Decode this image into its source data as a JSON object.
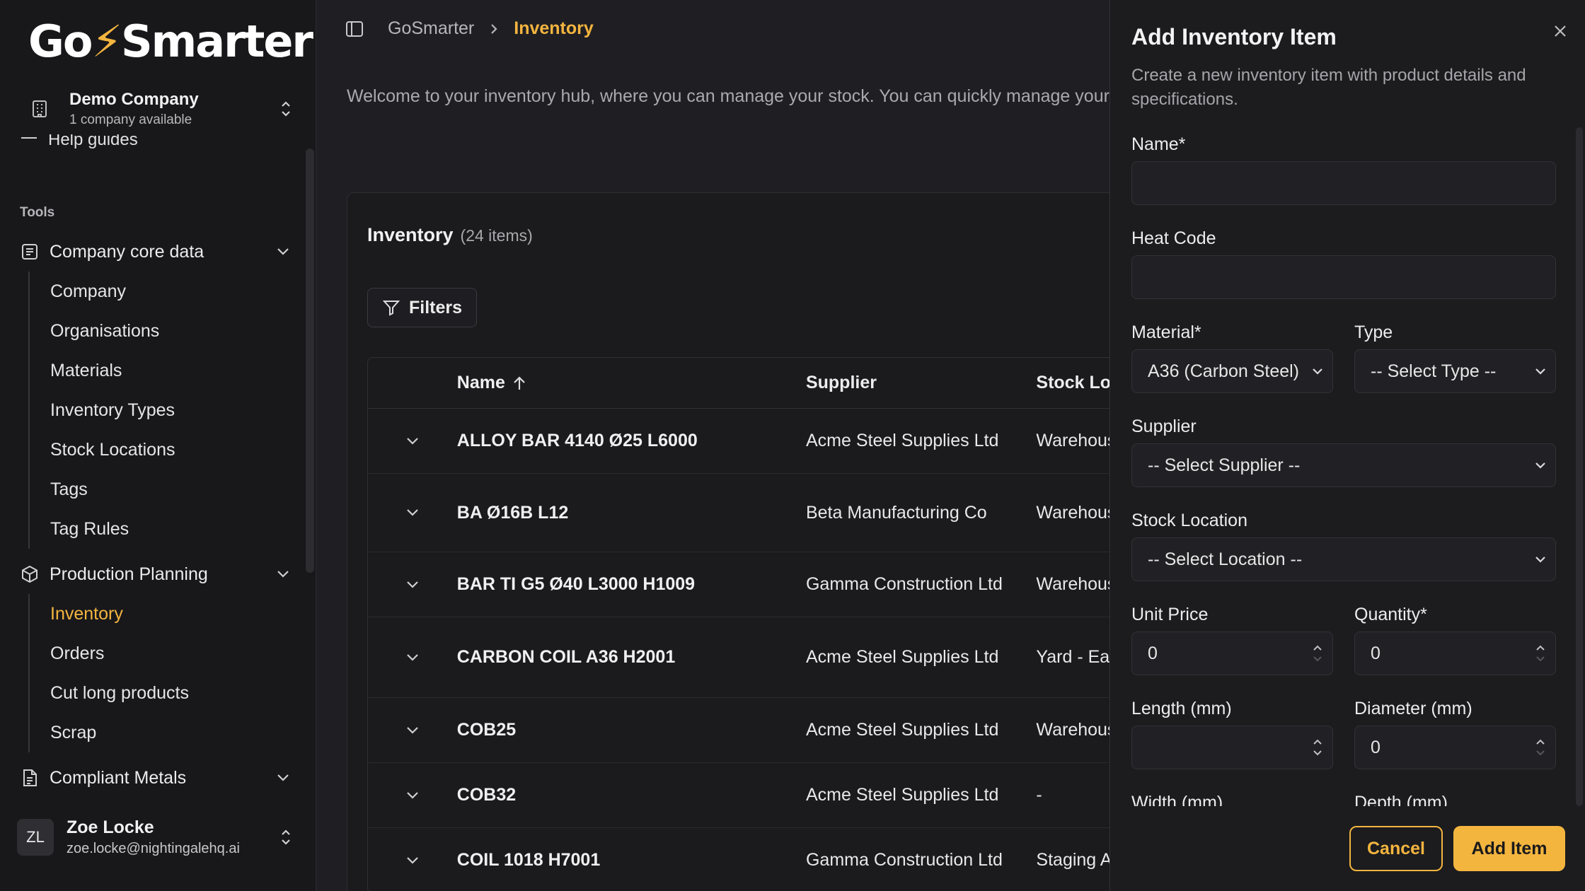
{
  "brand": {
    "logo_left": "Go",
    "logo_bolt": "⚡",
    "logo_right": "Smarter",
    "accent_color": "#f4b53f"
  },
  "company_switcher": {
    "name": "Demo Company",
    "subtitle": "1 company available"
  },
  "sidebar": {
    "partial_item": "Help guides",
    "section_label": "Tools",
    "groups": [
      {
        "label": "Company core data",
        "icon": "database-icon",
        "children": [
          "Company",
          "Organisations",
          "Materials",
          "Inventory Types",
          "Stock Locations",
          "Tags",
          "Tag Rules"
        ]
      },
      {
        "label": "Production Planning",
        "icon": "package-icon",
        "children": [
          "Inventory",
          "Orders",
          "Cut long products",
          "Scrap"
        ],
        "active_child": "Inventory"
      },
      {
        "label": "Compliant Metals",
        "icon": "document-icon",
        "children": []
      }
    ]
  },
  "user": {
    "initials": "ZL",
    "name": "Zoe Locke",
    "email": "zoe.locke@nightingalehq.ai"
  },
  "breadcrumb": {
    "root": "GoSmarter",
    "current": "Inventory"
  },
  "welcome_text": "Welcome to your inventory hub, where you can manage your stock. You can quickly manage your in",
  "inventory": {
    "title": "Inventory",
    "count": "(24 items)",
    "filters_label": "Filters",
    "columns": {
      "name": "Name",
      "supplier": "Supplier",
      "location": "Stock Loc"
    },
    "rows": [
      {
        "name": "ALLOY BAR 4140 Ø25 L6000",
        "supplier": "Acme Steel Supplies Ltd",
        "location": "Warehous"
      },
      {
        "name": "BA Ø16B L12",
        "supplier": "Beta Manufacturing Co",
        "location": "Warehous"
      },
      {
        "name": "BAR TI G5 Ø40 L3000 H1009",
        "supplier": "Gamma Construction Ltd",
        "location": "Warehous"
      },
      {
        "name": "CARBON COIL A36 H2001",
        "supplier": "Acme Steel Supplies Ltd",
        "location": "Yard - Eas"
      },
      {
        "name": "COB25",
        "supplier": "Acme Steel Supplies Ltd",
        "location": "Warehous"
      },
      {
        "name": "COB32",
        "supplier": "Acme Steel Supplies Ltd",
        "location": "-"
      },
      {
        "name": "COIL 1018 H7001",
        "supplier": "Gamma Construction Ltd",
        "location": "Staging A"
      }
    ]
  },
  "drawer": {
    "title": "Add Inventory Item",
    "description": "Create a new inventory item with product details and specifications.",
    "fields": {
      "name_label": "Name*",
      "name_value": "",
      "heat_label": "Heat Code",
      "heat_value": "",
      "material_label": "Material*",
      "material_value": "A36 (Carbon Steel)",
      "type_label": "Type",
      "type_value": "-- Select Type --",
      "supplier_label": "Supplier",
      "supplier_value": "-- Select Supplier --",
      "location_label": "Stock Location",
      "location_value": "-- Select Location --",
      "price_label": "Unit Price",
      "price_value": "0",
      "qty_label": "Quantity*",
      "qty_value": "0",
      "length_label": "Length (mm)",
      "length_value": "",
      "diameter_label": "Diameter (mm)",
      "diameter_value": "0",
      "width_label": "Width (mm)",
      "depth_label": "Depth (mm)"
    },
    "cancel_label": "Cancel",
    "submit_label": "Add Item"
  }
}
